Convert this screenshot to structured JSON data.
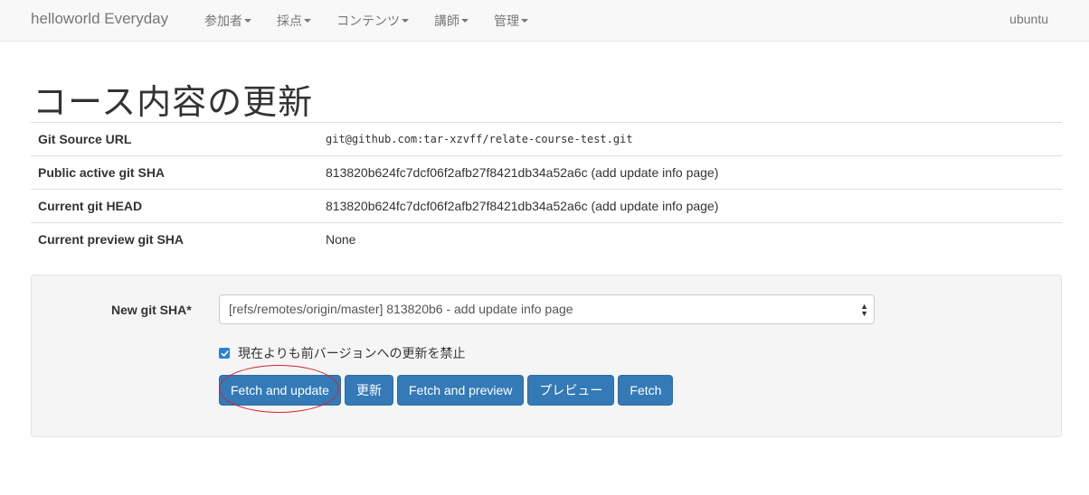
{
  "navbar": {
    "brand": "helloworld Everyday",
    "menu": [
      "参加者",
      "採点",
      "コンテンツ",
      "講師",
      "管理"
    ],
    "user": "ubuntu"
  },
  "page_title": "コース内容の更新",
  "info_table": [
    {
      "label": "Git Source URL",
      "value": "git@github.com:tar-xzvff/relate-course-test.git"
    },
    {
      "label": "Public active git SHA",
      "value": "813820b624fc7dcf06f2afb27f8421db34a52a6c (add update info page)"
    },
    {
      "label": "Current git HEAD",
      "value": "813820b624fc7dcf06f2afb27f8421db34a52a6c (add update info page)"
    },
    {
      "label": "Current preview git SHA",
      "value": "None"
    }
  ],
  "form": {
    "sha_label": "New git SHA*",
    "sha_selected": "[refs/remotes/origin/master] 813820b6 - add update info page",
    "prevent_downgrade_label": "現在よりも前バージョンへの更新を禁止",
    "prevent_downgrade_checked": true,
    "buttons": [
      "Fetch and update",
      "更新",
      "Fetch and preview",
      "プレビュー",
      "Fetch"
    ]
  },
  "colors": {
    "primary": "#337ab7",
    "annotation": "#d9232a"
  }
}
